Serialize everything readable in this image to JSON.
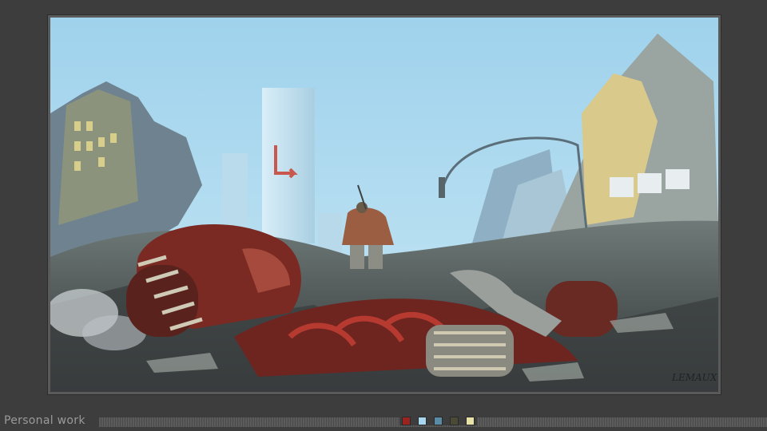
{
  "caption": {
    "label": "Personal work"
  },
  "artwork": {
    "signature": "LEMAUX"
  },
  "swatches": [
    {
      "name": "swatch-red",
      "color": "#9b2420"
    },
    {
      "name": "swatch-light-blue",
      "color": "#a8d6ee"
    },
    {
      "name": "swatch-steel-blue",
      "color": "#5b8aa4"
    },
    {
      "name": "swatch-olive",
      "color": "#4a4a36"
    },
    {
      "name": "swatch-pale-yellow",
      "color": "#e6e2a8"
    }
  ]
}
